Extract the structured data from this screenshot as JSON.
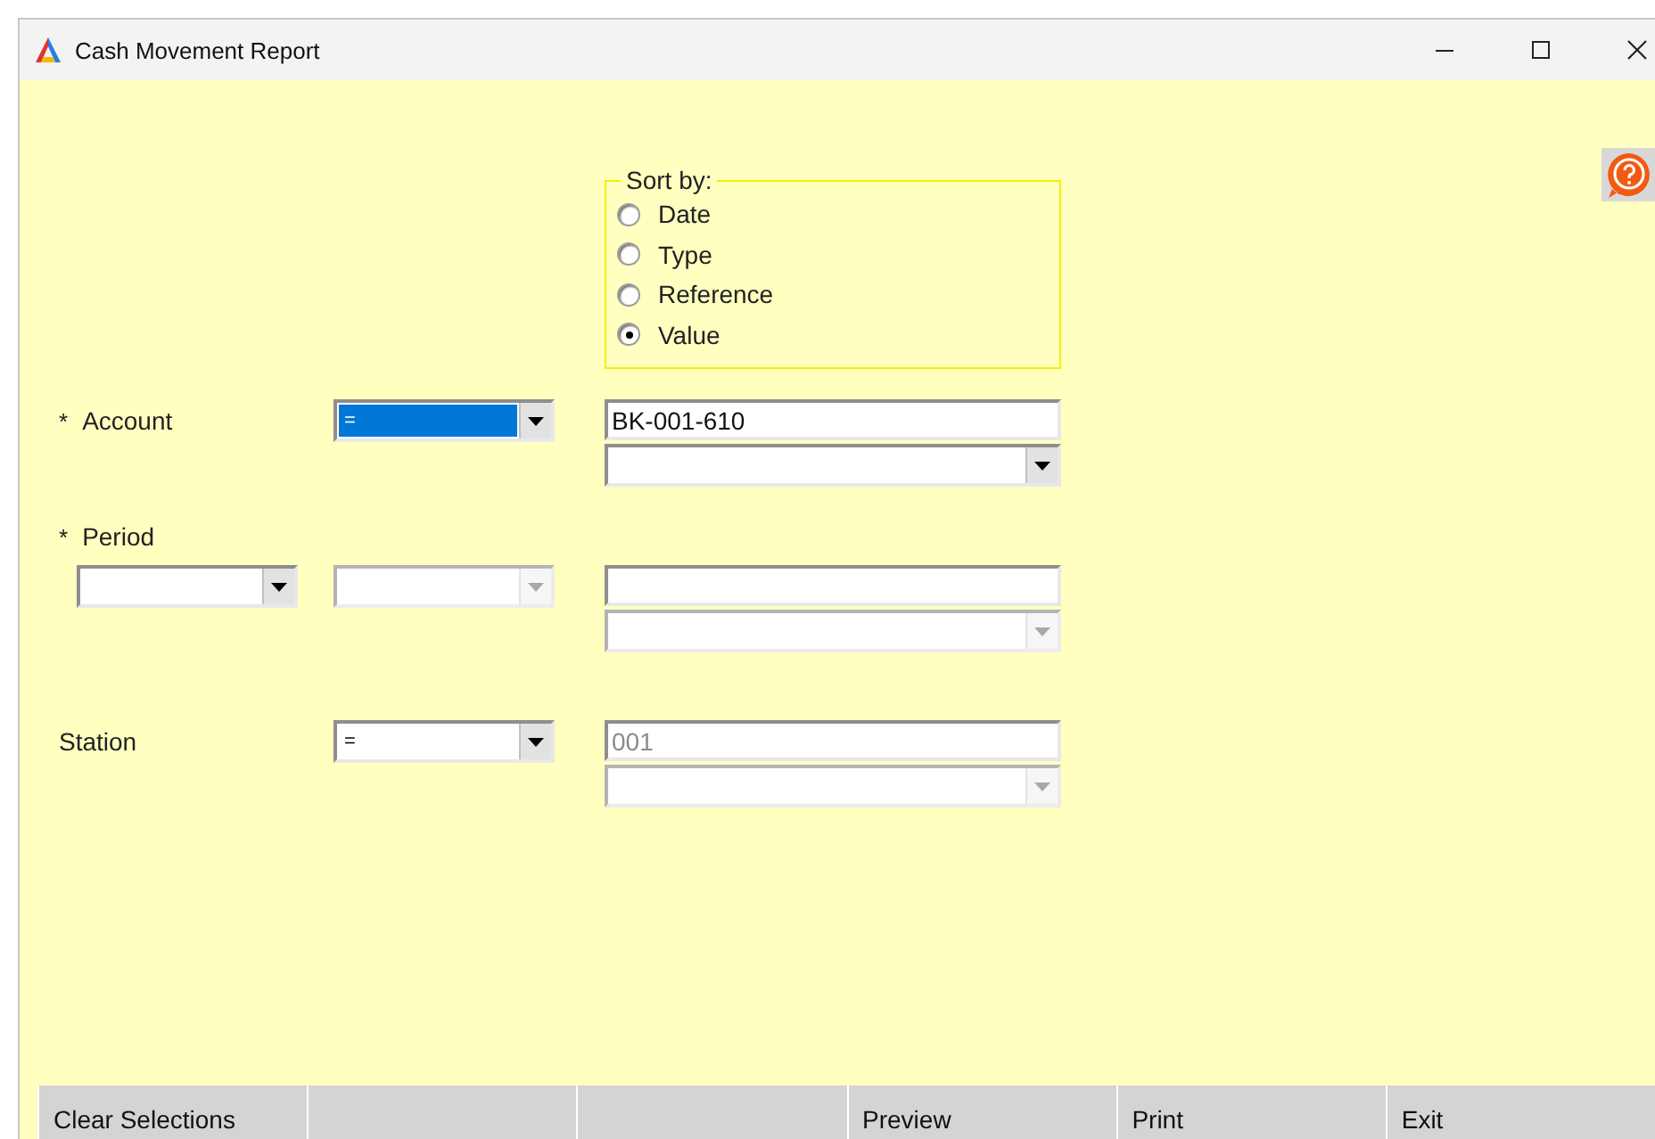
{
  "window": {
    "title": "Cash Movement Report"
  },
  "sort_by": {
    "label": "Sort by:",
    "options": [
      {
        "label": "Date",
        "selected": false
      },
      {
        "label": "Type",
        "selected": false
      },
      {
        "label": "Reference",
        "selected": false
      },
      {
        "label": "Value",
        "selected": true
      }
    ]
  },
  "filters": [
    {
      "kind": "single",
      "label": "Account",
      "required_mark": "*",
      "operator": {
        "value": "=",
        "focused": true,
        "disabled": false
      },
      "value_field": {
        "value": "BK-001-610",
        "disabled": false
      },
      "value_list": {
        "disabled": false
      }
    },
    {
      "kind": "range",
      "label": "Period",
      "required_mark": "*",
      "period_select": {
        "disabled": false
      },
      "operator": {
        "focused": false,
        "disabled": true
      },
      "value_list": {
        "disabled": true
      }
    },
    {
      "kind": "single",
      "label": "Station",
      "operator": {
        "value": "=",
        "focused": false,
        "disabled": false
      },
      "value_field": {
        "value": "001",
        "disabled": true
      },
      "value_list": {
        "disabled": true
      }
    }
  ],
  "buttons": [
    {
      "kind": "labeled",
      "label": "Clear Selections"
    },
    {
      "kind": "blank"
    },
    {
      "kind": "blank"
    },
    {
      "kind": "labeled",
      "label": "Preview"
    },
    {
      "kind": "labeled",
      "label": "Print"
    },
    {
      "kind": "labeled",
      "label": "Exit"
    }
  ]
}
